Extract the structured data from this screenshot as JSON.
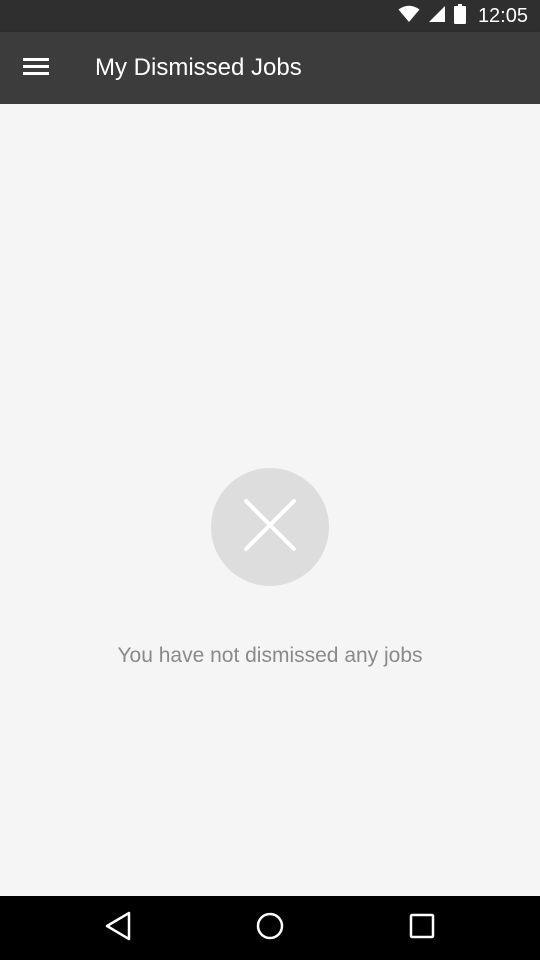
{
  "status_bar": {
    "time": "12:05",
    "icons": [
      "wifi-icon",
      "signal-icon",
      "battery-icon"
    ]
  },
  "app_bar": {
    "menu_icon": "hamburger-menu-icon",
    "title": "My Dismissed Jobs"
  },
  "empty_state": {
    "icon": "close-icon",
    "message": "You have not dismissed any jobs"
  },
  "nav_bar": {
    "buttons": [
      "back-icon",
      "home-icon",
      "recents-icon"
    ]
  },
  "colors": {
    "status_bar": "#2f2f2f",
    "app_bar": "#3c3c3c",
    "background": "#f5f5f5",
    "empty_icon_bg": "#dddddd",
    "message_text": "#8a8a8a"
  }
}
